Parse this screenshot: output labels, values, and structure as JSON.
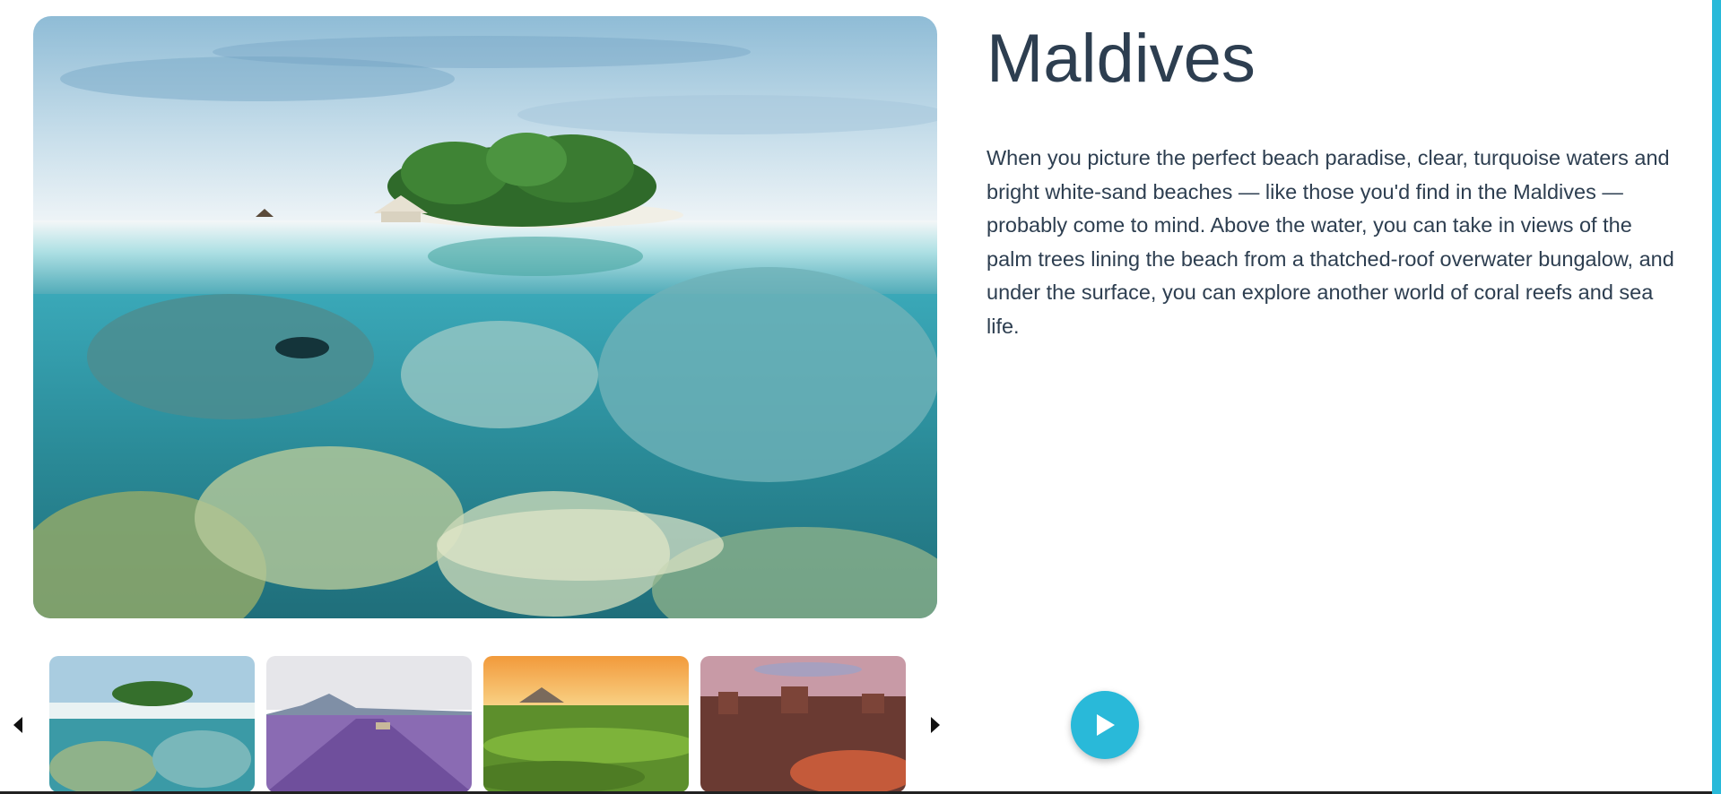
{
  "destination": {
    "title": "Maldives",
    "description": "When you picture the perfect beach paradise, clear, turquoise waters and bright white-sand beaches — like those you'd find in the Maldives — probably come to mind. Above the water, you can take in views of the palm trees lining the beach from a thatched-roof overwater bungalow, and under the surface, you can explore another world of coral reefs and sea life."
  },
  "carousel": {
    "prev_icon": "caret-left-icon",
    "next_icon": "caret-right-icon",
    "thumbnails": [
      {
        "scene": "maldives-island-coral-reef"
      },
      {
        "scene": "lavender-field-mountain"
      },
      {
        "scene": "rice-terraces-sunset-volcano"
      },
      {
        "scene": "desert-canyon-mesas"
      }
    ]
  },
  "controls": {
    "play_icon": "play-icon"
  },
  "colors": {
    "text": "#2d3e50",
    "accent": "#29b9d9"
  }
}
